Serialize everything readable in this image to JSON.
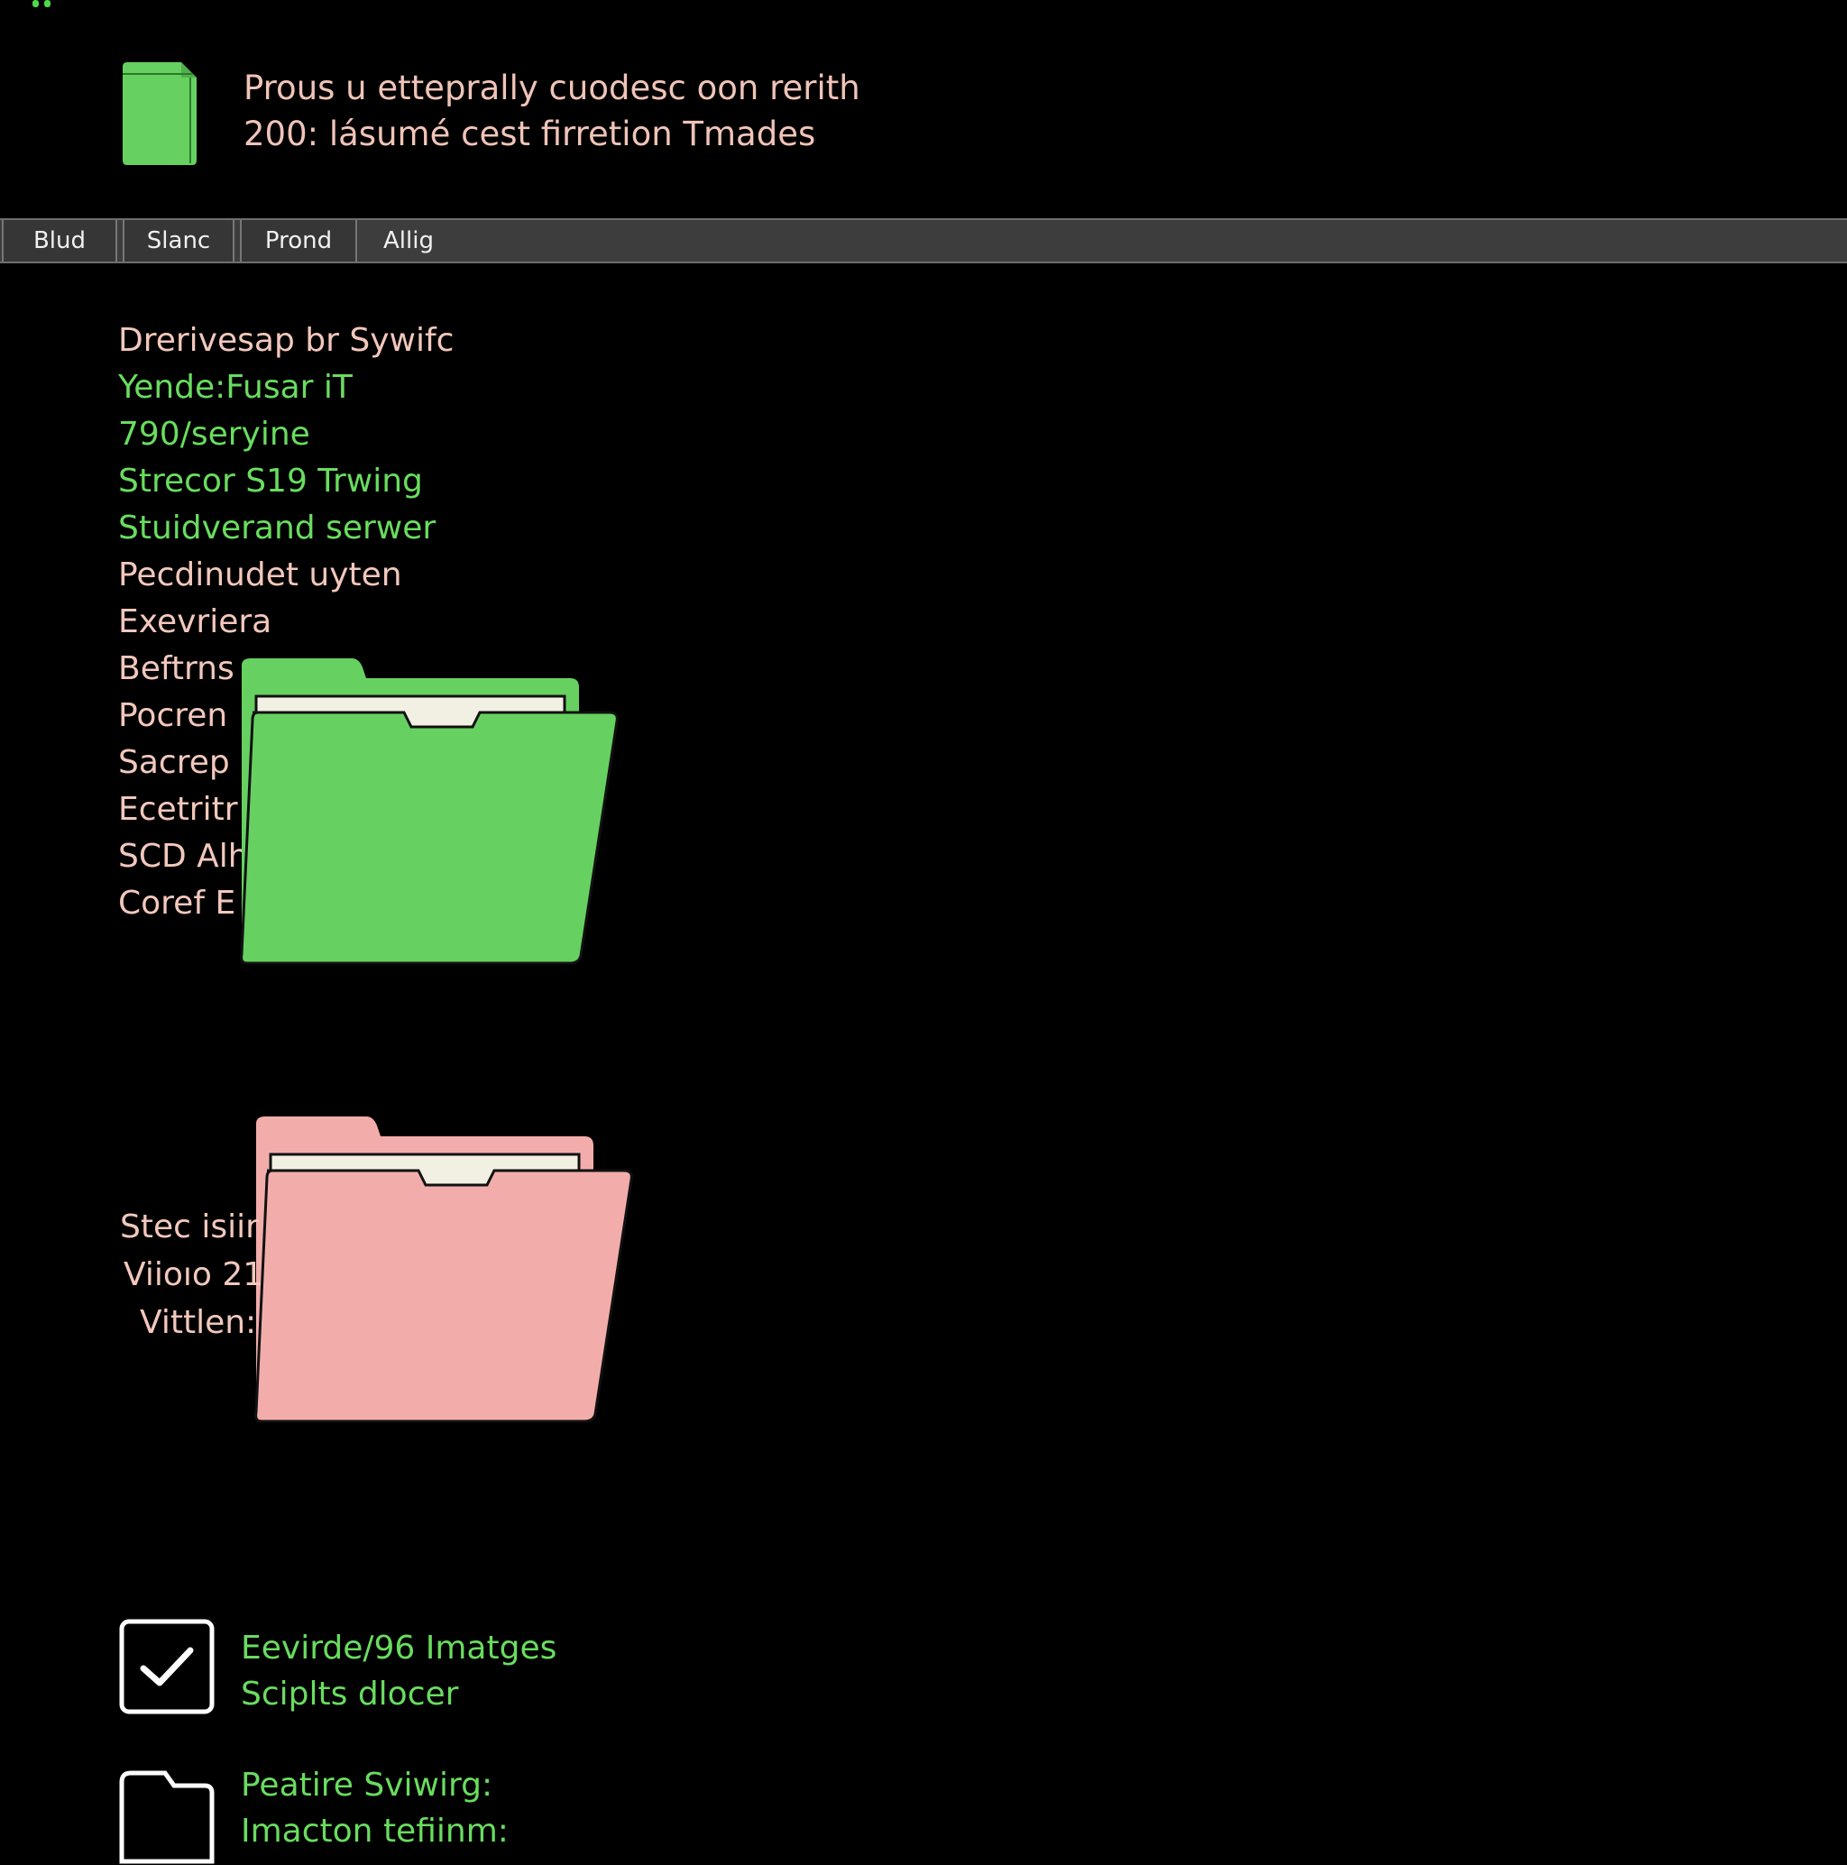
{
  "colors": {
    "background": "#000000",
    "accent_green": "#69dc5f",
    "text_pink": "#f2c8bc",
    "folder_green": "#66d161",
    "folder_pink": "#f2adab",
    "tabbar": "#3d3d3d"
  },
  "header": {
    "icon": "document-icon",
    "line1": "Prous u etteprally cuodesc oon rerith",
    "line2": "200: lásumé cest firretion Tmades"
  },
  "tabs": [
    {
      "label": "Blud"
    },
    {
      "label": "Slanc"
    },
    {
      "label": "Prond"
    },
    {
      "label": "Allig"
    }
  ],
  "list": [
    {
      "text": "Drerivesap br Sywifc"
    },
    {
      "text": "Yende:Fusar iT"
    },
    {
      "text": "790/seryine"
    },
    {
      "text": "Strecor S19 Trwing"
    },
    {
      "text": "Stuidverand serwer"
    },
    {
      "text": "Pecdinudet uyten"
    },
    {
      "text": "Exevriera"
    },
    {
      "text": "Beftrns"
    },
    {
      "text": "Pocren"
    },
    {
      "text": "Sacrep"
    },
    {
      "text": "Ecetritr"
    },
    {
      "text": "SCD Alh"
    },
    {
      "text": "Coref E"
    }
  ],
  "folders": {
    "green": {
      "icon": "folder-open-icon",
      "color": "green"
    },
    "pink": {
      "icon": "folder-open-icon",
      "color": "pink"
    }
  },
  "list2": [
    {
      "text": "Stec isiir"
    },
    {
      "text": "Viioıo 21"
    },
    {
      "text": "Vittlen:"
    }
  ],
  "bottom_rows": [
    {
      "icon": "checkbox-checked-icon",
      "line1": "Eevirde/96 Imatges",
      "line2": "Sciplts dlocer"
    },
    {
      "icon": "folder-outline-icon",
      "line1": "Peatire Sviwirg:",
      "line2": "Imacton tefiinm:"
    }
  ]
}
